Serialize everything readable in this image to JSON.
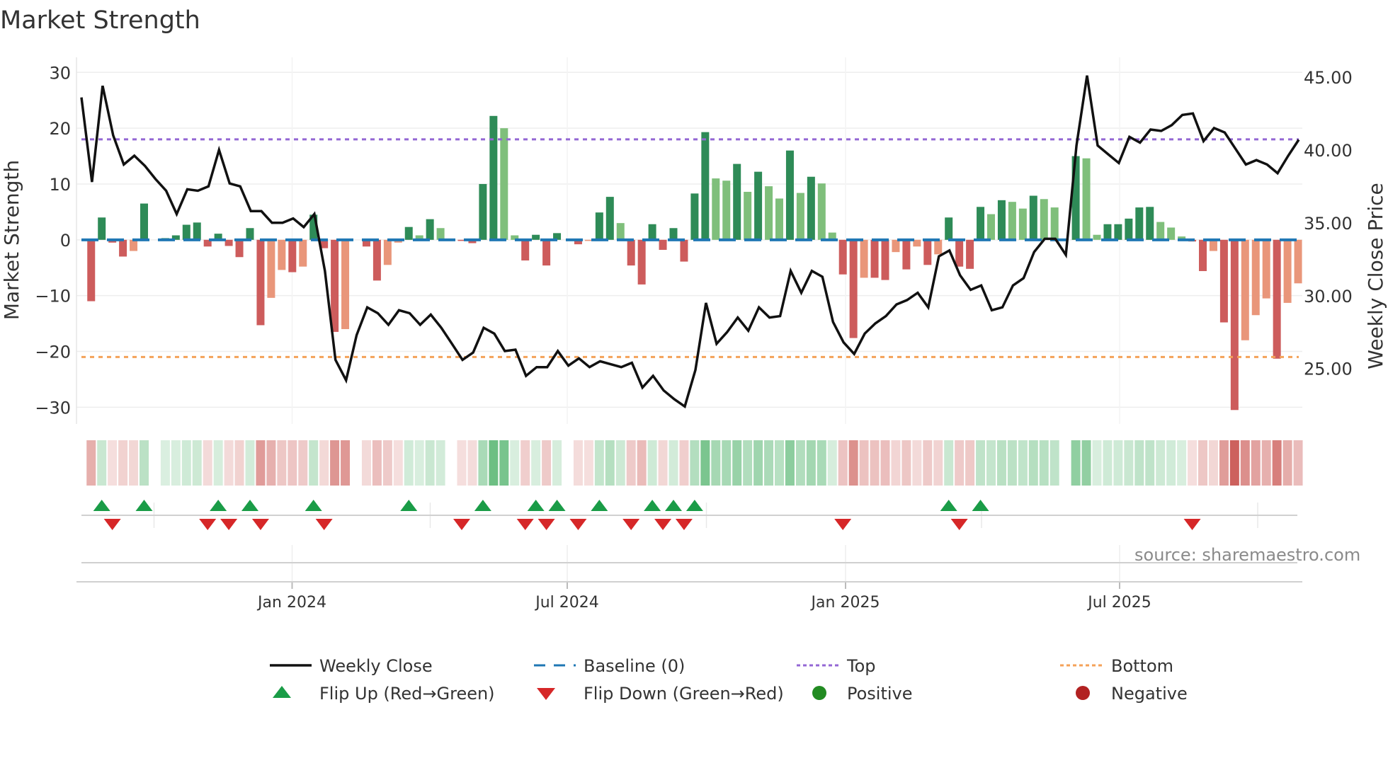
{
  "chart_data": {
    "type": "bar",
    "title": "Market Strength",
    "ylabel": "Market Strength",
    "y2label": "Weekly Close Price",
    "ylim": [
      -33,
      32.7
    ],
    "y2lim": [
      21.2,
      46.35
    ],
    "yticks": [
      30,
      20,
      10,
      0,
      -10,
      -20,
      -30
    ],
    "ytick_labels": [
      "30",
      "20",
      "10",
      "0",
      "−10",
      "−20",
      "−30"
    ],
    "y2ticks": [
      45,
      40,
      35,
      30,
      25
    ],
    "y2tick_labels": [
      "45.00",
      "40.00",
      "35.00",
      "30.00",
      "25.00"
    ],
    "xticks": [
      "Jan 2024",
      "Jul 2024",
      "Jan 2025",
      "Jul 2025"
    ],
    "x_frequency": "weekly",
    "top_level": 18,
    "bottom_level": -21,
    "baseline": 0,
    "strength": [
      -11,
      4,
      -0.5,
      -3,
      -2,
      6.5,
      0,
      0.3,
      0.8,
      2.7,
      3.1,
      -1.2,
      1.1,
      -1.1,
      -3.1,
      2.1,
      -15.3,
      -10.4,
      -5.4,
      -5.8,
      -4.8,
      4.5,
      -1.5,
      -16.5,
      -16,
      0,
      -1.2,
      -7.3,
      -4.5,
      -0.5,
      2.3,
      0.8,
      3.7,
      2.1,
      0,
      -0.2,
      -0.6,
      10,
      22.2,
      20,
      0.8,
      -3.7,
      0.9,
      -4.6,
      1.2,
      0,
      -0.8,
      -0.2,
      4.9,
      7.7,
      3,
      -4.6,
      -8,
      2.8,
      -1.8,
      2.1,
      -3.9,
      8.3,
      19.3,
      11,
      10.6,
      13.6,
      8.6,
      12.2,
      9.6,
      7.4,
      16,
      8.4,
      11.3,
      10.1,
      1.3,
      -6.2,
      -17.6,
      -6.8,
      -6.8,
      -7.2,
      -2.2,
      -5.3,
      -1.2,
      -4.5,
      -2.6,
      4,
      -4.8,
      -5.2,
      5.9,
      4.6,
      7.1,
      6.8,
      5.6,
      7.9,
      7.3,
      5.8,
      0,
      15,
      14.6,
      0.9,
      2.8,
      2.8,
      3.8,
      5.8,
      5.9,
      3.2,
      2.2,
      0.6,
      -0.3,
      -5.6,
      -2,
      -14.8,
      -30.5,
      -18,
      -13.5,
      -10.5,
      -21.3,
      -11.3,
      -7.8
    ],
    "weekly_close": [
      43.6,
      37.8,
      44.4,
      41.0,
      39.0,
      39.6,
      38.9,
      38.0,
      37.2,
      35.6,
      37.3,
      37.2,
      37.5,
      40.0,
      37.7,
      37.5,
      35.8,
      35.8,
      35.0,
      35.0,
      35.3,
      34.7,
      35.6,
      31.7,
      25.6,
      24.2,
      27.3,
      29.2,
      28.8,
      28.0,
      29.0,
      28.8,
      28.0,
      28.7,
      27.8,
      26.7,
      25.6,
      26.1,
      27.8,
      27.4,
      26.2,
      26.3,
      24.5,
      25.1,
      25.1,
      26.2,
      25.2,
      25.7,
      25.1,
      25.5,
      25.3,
      25.1,
      25.4,
      23.7,
      24.5,
      23.5,
      22.9,
      22.4,
      24.9,
      29.5,
      26.7,
      27.5,
      28.5,
      27.6,
      29.2,
      28.5,
      28.6,
      31.7,
      30.2,
      31.7,
      31.3,
      28.2,
      26.8,
      26.0,
      27.4,
      28.1,
      28.6,
      29.4,
      29.7,
      30.2,
      29.2,
      32.7,
      33.1,
      31.4,
      30.4,
      30.7,
      29.0,
      29.2,
      30.7,
      31.2,
      33.0,
      33.9,
      33.9,
      32.8,
      40.3,
      45.1,
      40.3,
      39.7,
      39.1,
      40.9,
      40.5,
      41.4,
      41.3,
      41.7,
      42.4,
      42.5,
      40.6,
      41.5,
      41.2,
      40.1,
      39.0,
      39.3,
      39.0,
      38.4,
      39.6,
      40.7
    ],
    "flip_up_weeks": [
      1,
      5,
      12,
      15,
      21,
      30,
      37,
      42,
      44,
      48,
      53,
      55,
      57,
      81,
      84
    ],
    "flip_down_weeks": [
      2,
      11,
      13,
      16,
      22,
      35,
      41,
      43,
      46,
      51,
      54,
      56,
      71,
      82,
      104
    ],
    "legend": {
      "weekly_close": "Weekly Close",
      "baseline": "Baseline (0)",
      "top": "Top",
      "bottom": "Bottom",
      "flip_up": "Flip Up (Red→Green)",
      "flip_down": "Flip Down (Green→Red)",
      "positive": "Positive",
      "negative": "Negative"
    },
    "legend_position": "bottom",
    "source": "source: sharemaestro.com",
    "colors": {
      "pos_strong": "#2e8b57",
      "pos_weak": "#7fbf7b",
      "neg_strong": "#cd5c5c",
      "neg_weak": "#e9967a",
      "baseline": "#1f77b4",
      "top": "#9467d4",
      "bottom": "#f4a259",
      "line": "#111111",
      "flip_up": "#1a9c47",
      "flip_down": "#d62728",
      "positive_dot": "#228b22",
      "negative_dot": "#b22222"
    }
  }
}
